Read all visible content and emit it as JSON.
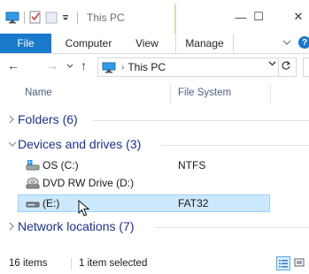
{
  "window": {
    "title": "This PC",
    "quick_access": [
      "pc-icon",
      "properties-icon",
      "new-folder-icon",
      "customize-arrow-icon"
    ],
    "controls": {
      "minimize": "—",
      "maximize": "☐",
      "close": "✕"
    }
  },
  "ribbon": {
    "tabs": [
      {
        "label": "File"
      },
      {
        "label": "Computer"
      },
      {
        "label": "View"
      },
      {
        "label": "Manage"
      }
    ],
    "accent_color": "#1979ca",
    "manage_stripe_color": "#c9e8a9"
  },
  "nav": {
    "back": "←",
    "forward": "→",
    "up": "↑",
    "address": "This PC",
    "separator": "›"
  },
  "columns": {
    "name": "Name",
    "filesystem": "File System"
  },
  "groups": [
    {
      "label": "Folders (6)",
      "expanded": false
    },
    {
      "label": "Devices and drives (3)",
      "expanded": true
    },
    {
      "label": "Network locations (7)",
      "expanded": false
    }
  ],
  "drives": [
    {
      "name": "OS (C:)",
      "filesystem": "NTFS",
      "icon": "windows-drive-icon",
      "selected": false
    },
    {
      "name": "DVD RW Drive (D:)",
      "filesystem": "",
      "icon": "dvd-drive-icon",
      "selected": false
    },
    {
      "name": "(E:)",
      "filesystem": "FAT32",
      "icon": "removable-drive-icon",
      "selected": true
    }
  ],
  "status": {
    "items": "16 items",
    "selection": "1 item selected"
  },
  "colors": {
    "group_label": "#1e3287",
    "selection_bg": "#cce8ff",
    "selection_border": "#99d1ff"
  }
}
